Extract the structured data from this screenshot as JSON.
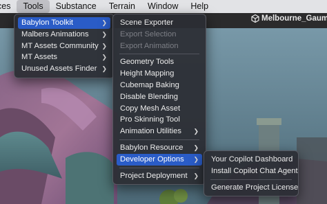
{
  "menubar": {
    "items": [
      "ces",
      "Tools",
      "Substance",
      "Terrain",
      "Window",
      "Help"
    ],
    "active_index": 1
  },
  "project": {
    "name": "Melbourne_Gaume",
    "icon": "unity-logo-icon"
  },
  "tools_menu": {
    "items": [
      {
        "label": "Babylon Toolkit",
        "submenu": true,
        "highlighted": true
      },
      {
        "label": "Malbers Animations",
        "submenu": true
      },
      {
        "label": "MT Assets Community",
        "submenu": true
      },
      {
        "label": "MT Assets",
        "submenu": true
      },
      {
        "label": "Unused Assets Finder",
        "submenu": true
      }
    ]
  },
  "babylon_menu": {
    "items": [
      {
        "label": "Scene Exporter"
      },
      {
        "label": "Export Selection",
        "disabled": true
      },
      {
        "label": "Export Animation",
        "disabled": true
      },
      {
        "label": "Geometry Tools"
      },
      {
        "label": "Height Mapping"
      },
      {
        "label": "Cubemap Baking"
      },
      {
        "label": "Disable Blending"
      },
      {
        "label": "Copy Mesh Asset"
      },
      {
        "label": "Pro Skinning Tool"
      },
      {
        "label": "Animation Utilities",
        "submenu": true
      },
      {
        "label": "Babylon Resource",
        "submenu": true
      },
      {
        "label": "Developer Options",
        "submenu": true,
        "highlighted": true
      },
      {
        "label": "Project Deployment",
        "submenu": true
      }
    ]
  },
  "developer_menu": {
    "items": [
      {
        "label": "Your Copilot Dashboard"
      },
      {
        "label": "Install Copilot Chat Agent"
      },
      {
        "label": "Generate Project License"
      }
    ]
  },
  "colors": {
    "highlight": "#2a5cc7",
    "menu_bg": "#2c2e34"
  }
}
